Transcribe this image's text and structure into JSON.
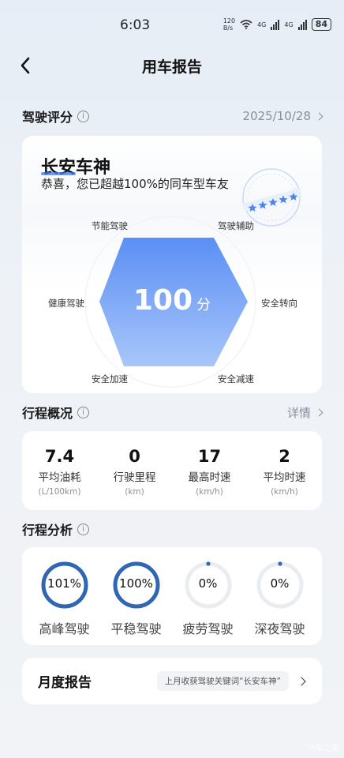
{
  "status": {
    "time": "6:03",
    "net_speed_value": "120",
    "net_speed_unit": "B/s",
    "sig1_label": "4G",
    "sig2_label": "4G",
    "battery": "84"
  },
  "nav": {
    "title": "用车报告"
  },
  "score": {
    "section_title": "驾驶评分",
    "date": "2025/10/28",
    "honor_title": "长安车神",
    "honor_sub": "恭喜，您已超越100%的同车型车友",
    "value": "100",
    "unit": "分",
    "dimensions": {
      "top_left": "节能驾驶",
      "top_right": "驾驶辅助",
      "left": "健康驾驶",
      "right": "安全转向",
      "bottom_left": "安全加速",
      "bottom_right": "安全减速"
    }
  },
  "trip": {
    "section_title": "行程概况",
    "detail_label": "详情",
    "stats": [
      {
        "value": "7.4",
        "label": "平均油耗",
        "unit": "(L/100km)"
      },
      {
        "value": "0",
        "label": "行驶里程",
        "unit": "(km)"
      },
      {
        "value": "17",
        "label": "最高时速",
        "unit": "(km/h)"
      },
      {
        "value": "2",
        "label": "平均时速",
        "unit": "(km/h)"
      }
    ]
  },
  "analysis": {
    "section_title": "行程分析",
    "items": [
      {
        "value": "101%",
        "label": "高峰驾驶",
        "fraction": 1.0
      },
      {
        "value": "100%",
        "label": "平稳驾驶",
        "fraction": 1.0
      },
      {
        "value": "0%",
        "label": "疲劳驾驶",
        "fraction": 0.0
      },
      {
        "value": "0%",
        "label": "深夜驾驶",
        "fraction": 0.0
      }
    ]
  },
  "monthly": {
    "title": "月度报告",
    "tag": "上月收获驾驶关键词“长安车神”"
  },
  "watermark": "汽车之家",
  "colors": {
    "accent": "#2f67b1",
    "hex_top": "#5b8ff5",
    "hex_bottom": "#a8c6f9",
    "track": "#e9edf2"
  }
}
